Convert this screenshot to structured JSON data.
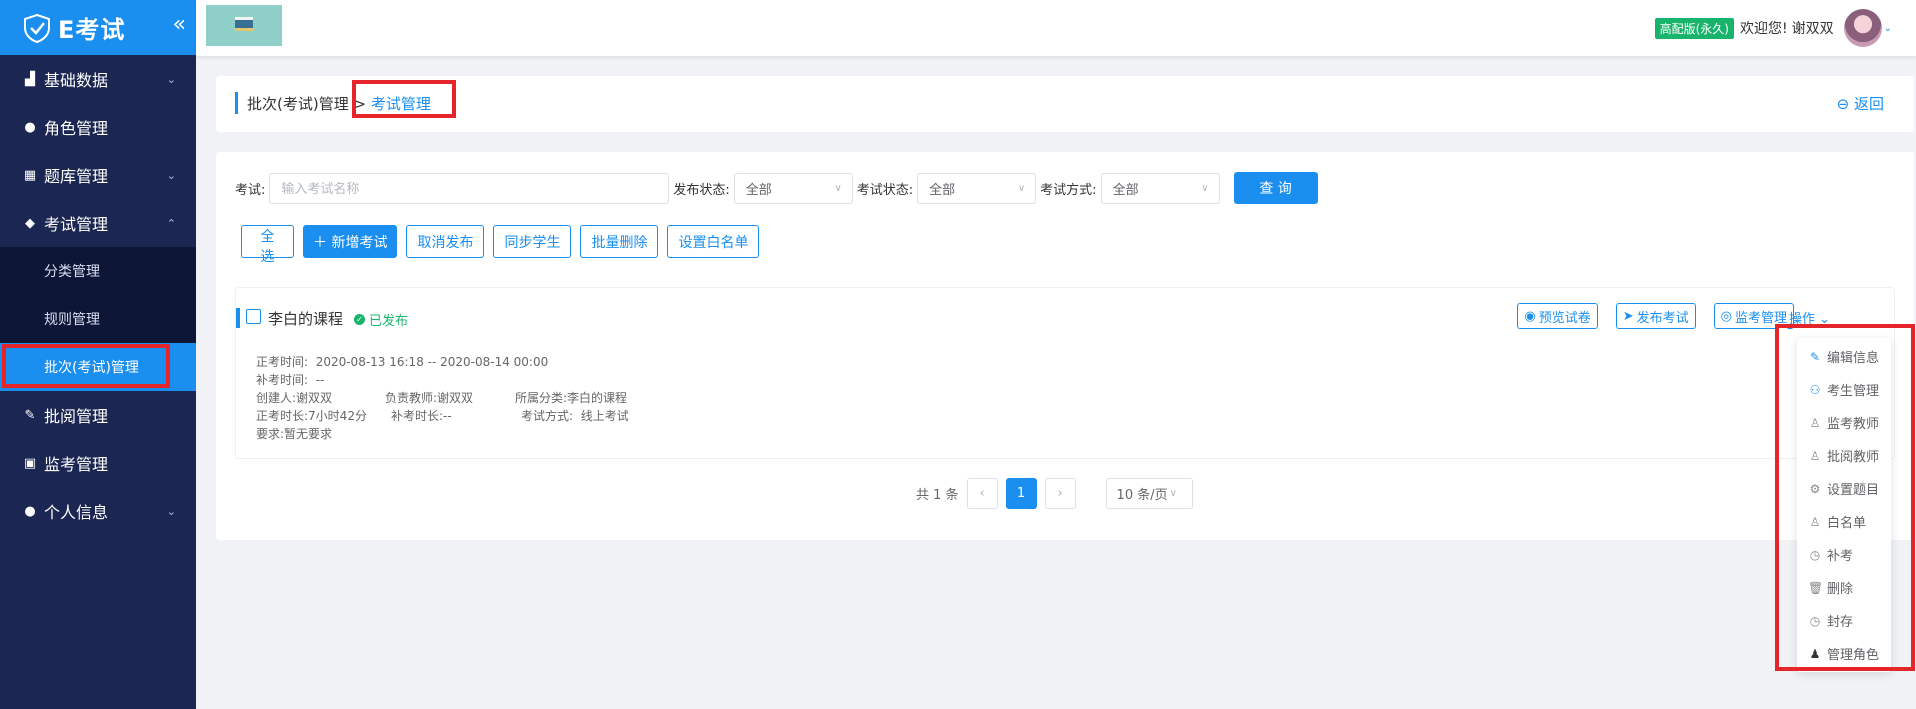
{
  "app": {
    "logo_text": "E考试"
  },
  "sidebar": {
    "items": [
      {
        "label": "基础数据",
        "icon": "chart-icon",
        "has_arrow": true
      },
      {
        "label": "角色管理",
        "icon": "user-icon",
        "has_arrow": false
      },
      {
        "label": "题库管理",
        "icon": "list-icon",
        "has_arrow": true
      },
      {
        "label": "考试管理",
        "icon": "location-icon",
        "has_arrow": true,
        "expanded": true
      },
      {
        "label": "批阅管理",
        "icon": "edit-icon",
        "has_arrow": false
      },
      {
        "label": "监考管理",
        "icon": "monitor-icon",
        "has_arrow": false
      },
      {
        "label": "个人信息",
        "icon": "person-icon",
        "has_arrow": true
      }
    ],
    "sub_items": [
      {
        "label": "分类管理"
      },
      {
        "label": "规则管理"
      },
      {
        "label": "批次(考试)管理",
        "active": true
      }
    ]
  },
  "header": {
    "edition": "高配版(永久)",
    "welcome": "欢迎您!",
    "username": "谢双双"
  },
  "breadcrumb": {
    "parent": "批次(考试)管理",
    "separator": ">",
    "current": "考试管理",
    "back": "返回"
  },
  "filters": {
    "exam_label": "考试:",
    "exam_placeholder": "输入考试名称",
    "publish_label": "发布状态:",
    "publish_value": "全部",
    "exam_status_label": "考试状态:",
    "exam_status_value": "全部",
    "mode_label": "考试方式:",
    "mode_value": "全部",
    "query_button": "查 询"
  },
  "actions": {
    "select_all": "全 选",
    "add_exam": "新增考试",
    "cancel_publish": "取消发布",
    "sync_students": "同步学生",
    "batch_delete": "批量删除",
    "whitelist": "设置白名单"
  },
  "exam": {
    "title": "李白的课程",
    "status": "已发布",
    "buttons": {
      "preview": "预览试卷",
      "publish": "发布考试",
      "invigilate": "监考管理",
      "operate": "操作"
    },
    "info": {
      "exam_time_label": "正考时间:",
      "exam_time": "2020-08-13 16:18 -- 2020-08-14 00:00",
      "makeup_time_label": "补考时间:",
      "makeup_time": "--",
      "creator_label": "创建人:",
      "creator": "谢双双",
      "teacher_label": "负责教师:",
      "teacher": "谢双双",
      "category_label": "所属分类:",
      "category": "李白的课程",
      "duration_label": "正考时长:",
      "duration": "7小时42分",
      "makeup_duration_label": "补考时长:",
      "makeup_duration": "--",
      "mode_label": "考试方式:",
      "mode": "线上考试",
      "requirement_label": "要求:",
      "requirement": "暂无要求"
    }
  },
  "pagination": {
    "total": "共 1 条",
    "current_page": "1",
    "page_size": "10 条/页"
  },
  "dropdown": {
    "items": [
      {
        "label": "编辑信息",
        "icon": "edit-icon",
        "blue": true
      },
      {
        "label": "考生管理",
        "icon": "users-icon",
        "blue": true
      },
      {
        "label": "监考教师",
        "icon": "teacher-icon",
        "blue": false
      },
      {
        "label": "批阅教师",
        "icon": "reviewer-icon",
        "blue": false
      },
      {
        "label": "设置题目",
        "icon": "gear-icon",
        "blue": false
      },
      {
        "label": "白名单",
        "icon": "whitelist-icon",
        "blue": false
      },
      {
        "label": "补考",
        "icon": "makeup-icon",
        "blue": false
      },
      {
        "label": "删除",
        "icon": "trash-icon",
        "blue": false
      },
      {
        "label": "封存",
        "icon": "archive-icon",
        "blue": false
      },
      {
        "label": "管理角色",
        "icon": "role-icon",
        "blue": false
      }
    ]
  },
  "colors": {
    "primary": "#1a8ff0",
    "sidebar": "#1b2652",
    "highlight": "#e4262b",
    "success": "#19b46c"
  }
}
